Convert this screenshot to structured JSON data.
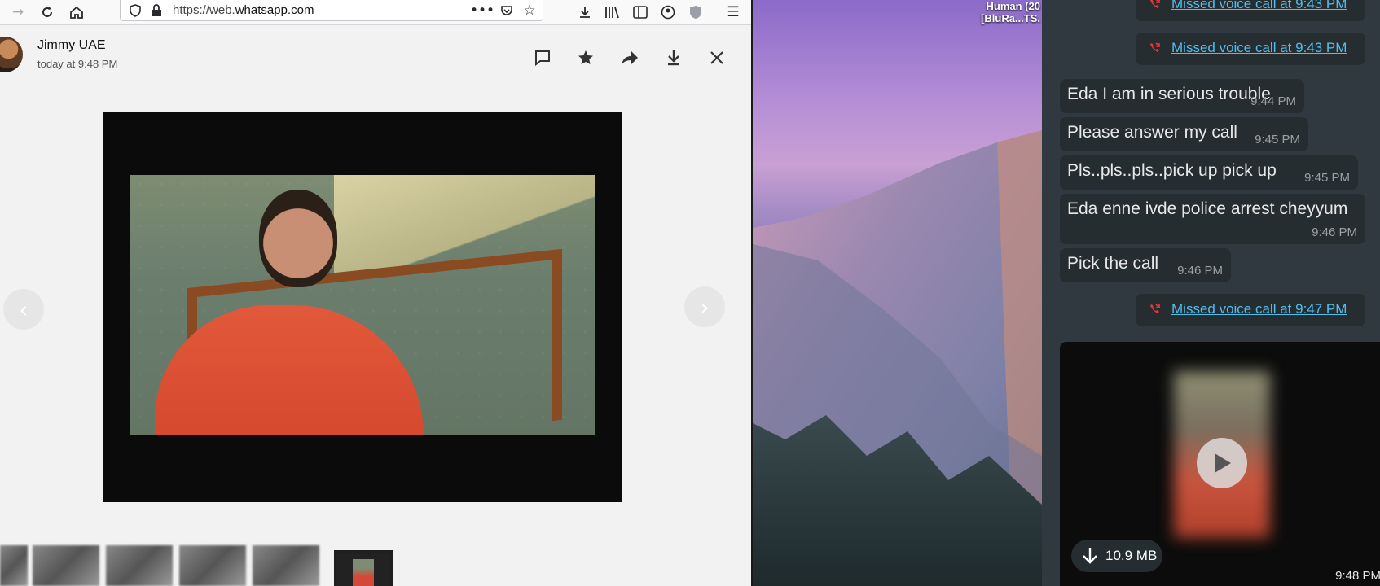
{
  "browser": {
    "url_prefix": "https://web.",
    "url_domain": "whatsapp.com",
    "icons": {
      "back": "back-arrow-icon",
      "forward": "forward-arrow-icon",
      "reload": "reload-icon",
      "home": "home-icon",
      "shield": "shield-icon",
      "lock": "lock-icon",
      "more": "more-dots-icon",
      "pocket": "pocket-icon",
      "bookmark": "star-icon",
      "downloads": "download-icon",
      "library": "library-icon",
      "sidebar": "sidebar-icon",
      "account": "account-icon",
      "extension": "shield-extension-icon",
      "menu": "hamburger-menu-icon"
    }
  },
  "viewer": {
    "contact_name": "Jimmy UAE",
    "timestamp": "today at 9:48 PM",
    "actions": [
      "message-icon",
      "star-icon",
      "forward-icon",
      "download-icon",
      "close-icon"
    ]
  },
  "desktop": {
    "label_line1": "Human (20",
    "label_line2": "[BluRa...TS."
  },
  "chat": {
    "calls": [
      {
        "text": "Missed voice call at 9:43 PM"
      },
      {
        "text": "Missed voice call at 9:43 PM"
      },
      {
        "text": "Missed voice call at 9:47 PM"
      }
    ],
    "messages": [
      {
        "text": "Eda I am in serious trouble",
        "time": "9:44 PM"
      },
      {
        "text": "Please answer my call",
        "time": "9:45 PM"
      },
      {
        "text": "Pls..pls..pls..pick up pick up",
        "time": "9:45 PM"
      },
      {
        "text": "Eda enne ivde police arrest cheyyum",
        "time": "9:46 PM"
      },
      {
        "text": "Pick the call",
        "time": "9:46 PM"
      }
    ],
    "video_message": {
      "size": "10.9 MB",
      "time": "9:48 PM"
    }
  },
  "colors": {
    "chat_bg": "#313940",
    "bubble_bg": "#262d31",
    "link_blue": "#53bdeb",
    "missed_red": "#e53935"
  }
}
